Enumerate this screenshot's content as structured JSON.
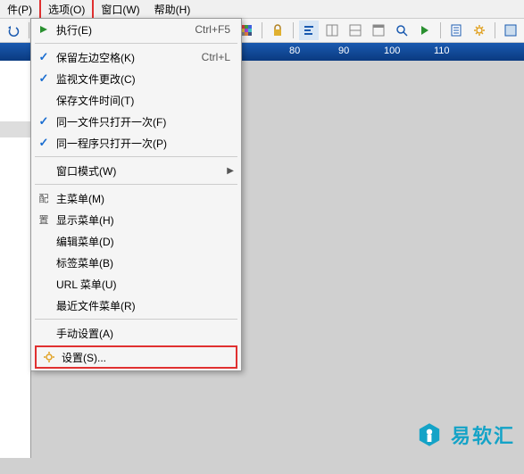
{
  "menubar": {
    "file": "件(P)",
    "options": "选项(O)",
    "window": "窗口(W)",
    "help": "帮助(H)"
  },
  "dropdown": {
    "execute": {
      "label": "执行(E)",
      "shortcut": "Ctrl+F5"
    },
    "keep_left_space": {
      "label": "保留左边空格(K)",
      "shortcut": "Ctrl+L"
    },
    "monitor_file_change": {
      "label": "监视文件更改(C)"
    },
    "save_file_time": {
      "label": "保存文件时间(T)"
    },
    "same_file_once": {
      "label": "同一文件只打开一次(F)"
    },
    "same_program_once": {
      "label": "同一程序只打开一次(P)"
    },
    "window_mode": {
      "label": "窗口模式(W)"
    },
    "side_config": "配",
    "side_set": "置",
    "main_menu": {
      "label": "主菜单(M)"
    },
    "display_menu": {
      "label": "显示菜单(H)"
    },
    "edit_menu": {
      "label": "编辑菜单(D)"
    },
    "tag_menu": {
      "label": "标签菜单(B)"
    },
    "url_menu": {
      "label": "URL 菜单(U)"
    },
    "recent_file_menu": {
      "label": "最近文件菜单(R)"
    },
    "manual_set": {
      "label": "手动设置(A)"
    },
    "settings": {
      "label": "设置(S)..."
    }
  },
  "ruler": {
    "ticks": [
      {
        "label": "80",
        "pos": 328
      },
      {
        "label": "90",
        "pos": 383
      },
      {
        "label": "100",
        "pos": 438
      },
      {
        "label": "110",
        "pos": 493
      }
    ]
  },
  "watermark": {
    "text": "易软汇"
  }
}
